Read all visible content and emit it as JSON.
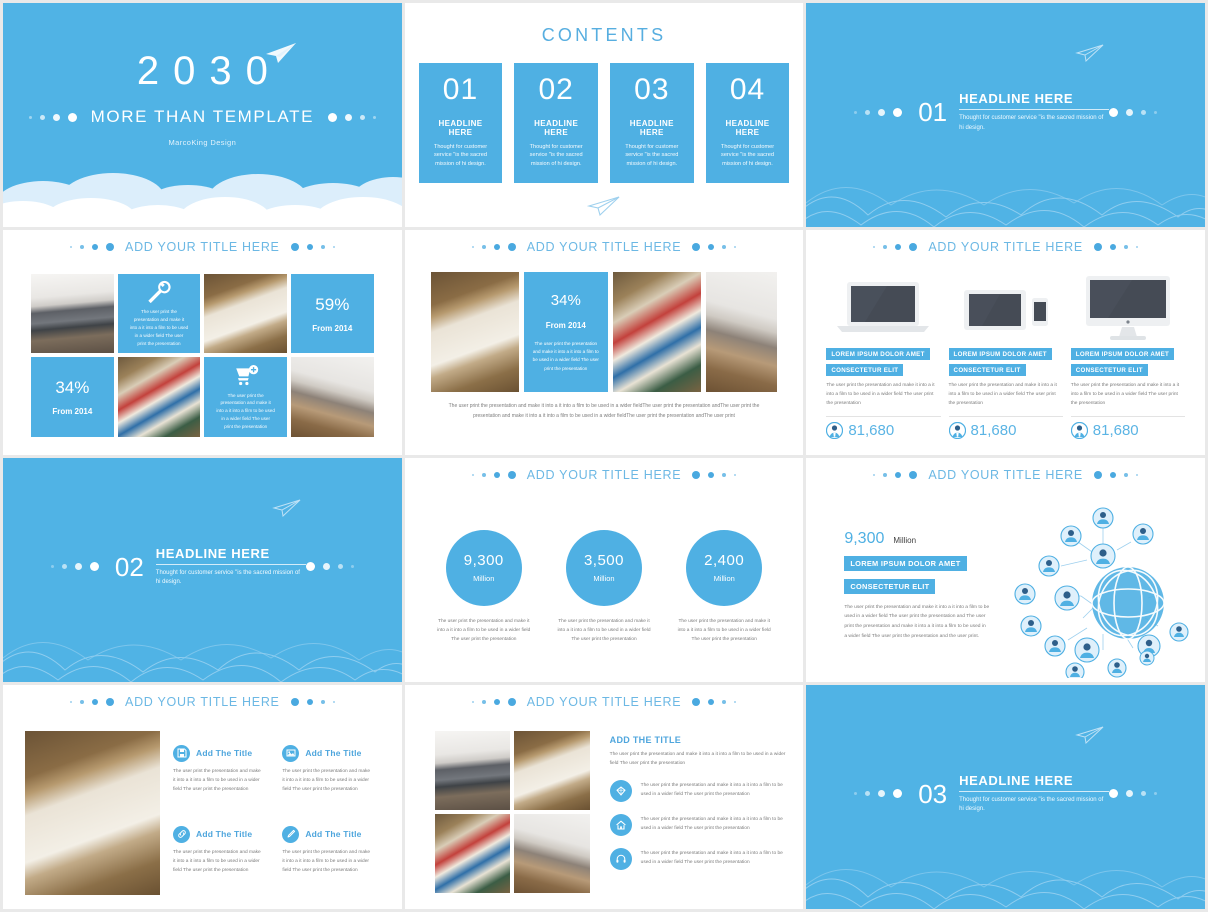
{
  "theme": {
    "accent": "#4fb0e3",
    "accent_light": "#6cb8e4",
    "text_gray": "#7b7b7b",
    "white": "#ffffff"
  },
  "common": {
    "section_title": "ADD YOUR TITLE HERE",
    "body_paragraph": "The user print the presentation and make it into a it into a film to be used in a wider field The user print the presentation",
    "body_paragraph_circle": "The user print the presentation and make it into a it into a film to be used in a wider field The user print the presentation",
    "icon_mini_paragraph": "The user print the presentation and make it into a it into a film to be used in a wider field The user print the presentation"
  },
  "slides": [
    {
      "id": "title-slide",
      "year": "2030",
      "subtitle": "MORE THAN TEMPLATE",
      "author": "MarcoKing Design"
    },
    {
      "id": "contents-slide",
      "title": "CONTENTS",
      "cards": [
        {
          "num": "01",
          "headline": "HEADLINE HERE",
          "body": "Thought for customer service \"is the sacred mission of hi design."
        },
        {
          "num": "02",
          "headline": "HEADLINE HERE",
          "body": "Thought for customer service \"is the sacred mission of hi design."
        },
        {
          "num": "03",
          "headline": "HEADLINE HERE",
          "body": "Thought for customer service \"is the sacred mission of hi design."
        },
        {
          "num": "04",
          "headline": "HEADLINE HERE",
          "body": "Thought for customer service \"is the sacred mission of hi design."
        }
      ]
    },
    {
      "id": "section-01",
      "num": "01",
      "headline": "HEADLINE HERE",
      "body": "Thought for customer service \"is the sacred mission of hi design."
    },
    {
      "id": "photo-grid-slide",
      "title": "ADD YOUR TITLE HERE",
      "cells": [
        {
          "type": "photo",
          "name": "desk-laptop-photo"
        },
        {
          "type": "icon",
          "icon": "wrench-icon",
          "body": "The user print the presentation and make it into a it into a film to be used in a wider field The user print the presentation"
        },
        {
          "type": "photo",
          "name": "book-stamp-photo"
        },
        {
          "type": "stat",
          "pct": "59%",
          "from": "From 2014"
        },
        {
          "type": "stat",
          "pct": "34%",
          "from": "From 2014"
        },
        {
          "type": "photo",
          "name": "typography-photo"
        },
        {
          "type": "icon",
          "icon": "add-cart-icon",
          "body": "The user print the presentation and make it into a it into a film to be used in a wider field The user print the presentation"
        },
        {
          "type": "photo",
          "name": "chairs-table-photo"
        }
      ]
    },
    {
      "id": "photo-row-slide",
      "title": "ADD YOUR TITLE HERE",
      "stat": {
        "pct": "34%",
        "from": "From 2014",
        "body": "The user print the presentation and make it into a it into a film to be used in a wider field The user print the presentation"
      },
      "caption": "The user print the presentation and make it into a it into a film to be used in a wider  fieldThe user print the presentation andThe user print the presentation and make it into a it into a film to be used in a wider fieldThe user print the presentation andThe user print"
    },
    {
      "id": "devices-slide",
      "title": "ADD YOUR TITLE HERE",
      "devices": [
        {
          "device": "laptop",
          "tag1": "LOREM IPSUM DOLOR AMET",
          "tag2": "CONSECTETUR ELIT",
          "body": "The user print the presentation and make it into a it into a film to be used in a wider field The user print the presentation",
          "count": "81,680"
        },
        {
          "device": "tablet-phone",
          "tag1": "LOREM IPSUM DOLOR AMET",
          "tag2": "CONSECTETUR ELIT",
          "body": "The user print the presentation and make it into a it into a film to be used in a wider field The user print the presentation",
          "count": "81,680"
        },
        {
          "device": "desktop",
          "tag1": "LOREM IPSUM DOLOR AMET",
          "tag2": "CONSECTETUR ELIT",
          "body": "The user print the presentation and make it into a it into a film to be used in a wider field The user print the presentation",
          "count": "81,680"
        }
      ]
    },
    {
      "id": "section-02",
      "num": "02",
      "headline": "HEADLINE HERE",
      "body": "Thought for customer service \"is the sacred mission of hi design."
    },
    {
      "id": "circles-slide",
      "title": "ADD YOUR TITLE HERE",
      "circles": [
        {
          "value": "9,300",
          "unit": "Million",
          "body": "The user print the presentation and make it into a it into a film to be used in a wider field The user print the presentation"
        },
        {
          "value": "3,500",
          "unit": "Million",
          "body": "The user print the presentation and make it into a it into a film to be used in a wider field The user print the presentation"
        },
        {
          "value": "2,400",
          "unit": "Million",
          "body": "The user print the presentation and make it into a it into a film to be used in a wider field The user print the presentation"
        }
      ]
    },
    {
      "id": "network-slide",
      "title": "ADD YOUR TITLE HERE",
      "number": "9,300",
      "unit": "Million",
      "tag1": "LOREM IPSUM DOLOR AMET",
      "tag2": "CONSECTETUR ELIT",
      "body": "The user print the presentation and make it into a it into a film to be used in a wider field The user print the presentation and The user print the presentation and make it into a it into a film to be used in a wider field The user print the presentation and the user print."
    },
    {
      "id": "features-slide",
      "title": "ADD YOUR TITLE HERE",
      "features": [
        {
          "icon": "save-disk-icon",
          "title": "Add The Title",
          "body": "The user print the presentation and make it into a it into a film to be used in a wider field The user print the presentation"
        },
        {
          "icon": "image-icon",
          "title": "Add The Title",
          "body": "The user print the presentation and make it into a it into a film to be used in a wider field The user print the presentation"
        },
        {
          "icon": "link-icon",
          "title": "Add The Title",
          "body": "The user print the presentation and make it into a it into a film to be used in a wider field The user print the presentation"
        },
        {
          "icon": "pencil-icon",
          "title": "Add The Title",
          "body": "The user print the presentation and make it into a it into a film to be used in a wider field The user print the presentation"
        }
      ]
    },
    {
      "id": "quad-list-slide",
      "title": "ADD YOUR TITLE HERE",
      "heading": "ADD THE TITLE",
      "intro": "The user print the presentation and make it into a it into a film to be used in a wider field The user print the presentation",
      "items": [
        {
          "icon": "diamond-icon",
          "body": "The user print the presentation and make it into a it into a film to be used in a wider field The user print the presentation"
        },
        {
          "icon": "home-icon",
          "body": "The user print the presentation and make it into a it into a film to be used in a wider field The user print the presentation"
        },
        {
          "icon": "headset-icon",
          "body": "The user print the presentation and make it into a it into a film to be used in a wider field The user print the presentation"
        }
      ]
    },
    {
      "id": "section-03",
      "num": "03",
      "headline": "HEADLINE HERE",
      "body": "Thought for customer service \"is the sacred mission of hi design."
    }
  ]
}
